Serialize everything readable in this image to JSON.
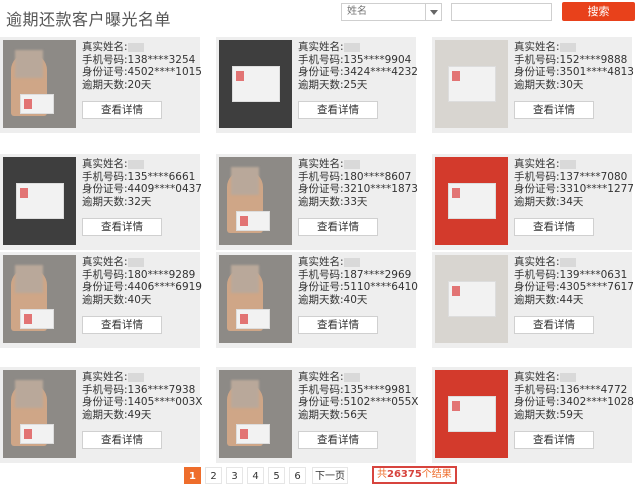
{
  "header": {
    "title": "逾期还款客户曝光名单",
    "select_value": "姓名",
    "search_placeholder": "",
    "search_button": "搜索"
  },
  "labels": {
    "name": "真实姓名:",
    "phone": "手机号码:",
    "id": "身份证号:",
    "days": "逾期天数:",
    "detail": "查看详情"
  },
  "records": [
    {
      "name": "",
      "phone": "138****3254",
      "id": "4502****1015",
      "days": "20天"
    },
    {
      "name": "",
      "phone": "135****9904",
      "id": "3424****4232",
      "days": "25天"
    },
    {
      "name": "",
      "phone": "152****9888",
      "id": "3501****4813",
      "days": "30天"
    },
    {
      "name": "",
      "phone": "135****6661",
      "id": "4409****0437",
      "days": "32天"
    },
    {
      "name": "",
      "phone": "180****8607",
      "id": "3210****1873",
      "days": "33天"
    },
    {
      "name": "",
      "phone": "137****7080",
      "id": "3310****1277",
      "days": "34天"
    },
    {
      "name": "",
      "phone": "180****9289",
      "id": "4406****6919",
      "days": "40天"
    },
    {
      "name": "",
      "phone": "187****2969",
      "id": "5110****6410",
      "days": "40天"
    },
    {
      "name": "",
      "phone": "139****0631",
      "id": "4305****7617",
      "days": "44天"
    },
    {
      "name": "",
      "phone": "136****7938",
      "id": "1405****003X",
      "days": "49天"
    },
    {
      "name": "",
      "phone": "135****9981",
      "id": "5102****055X",
      "days": "56天"
    },
    {
      "name": "",
      "phone": "136****4772",
      "id": "3402****1028",
      "days": "59天"
    }
  ],
  "pagination": {
    "pages": [
      "1",
      "2",
      "3",
      "4",
      "5",
      "6"
    ],
    "next": "下一页",
    "total_prefix": "共",
    "total_count": "26375",
    "total_suffix": "个结果"
  },
  "colors": {
    "accent": "#e8411b",
    "active_page": "#ee6d2b",
    "card_bg": "#eeeeee"
  }
}
